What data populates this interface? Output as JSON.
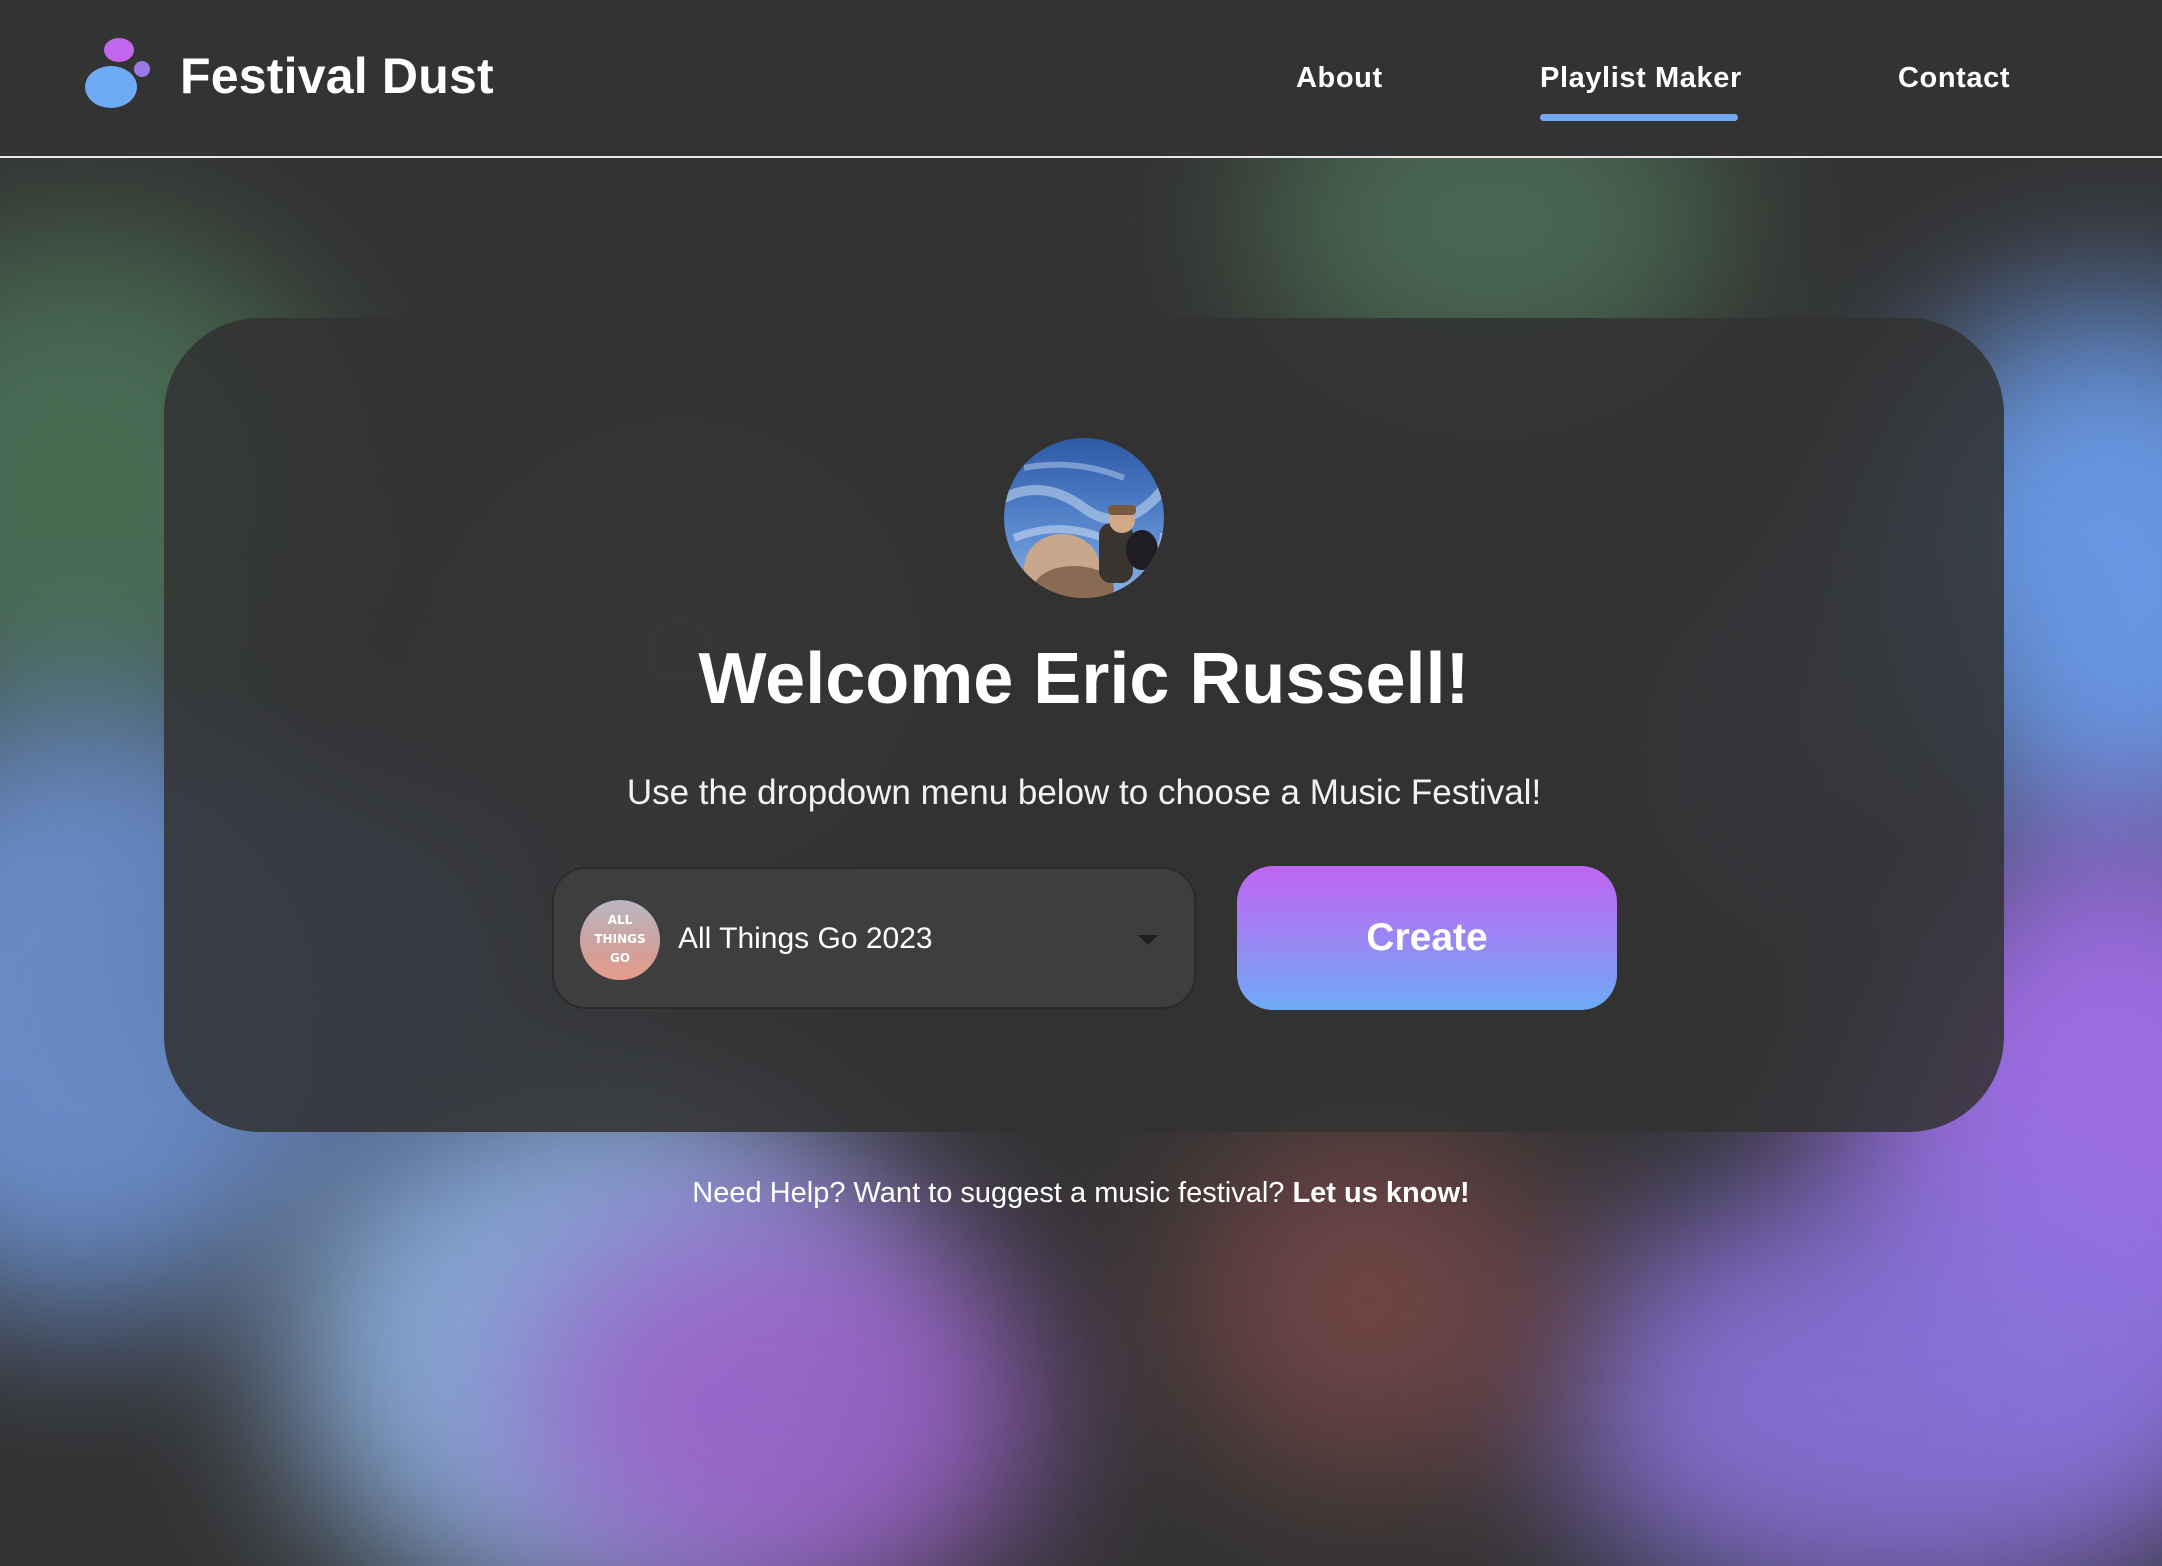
{
  "brand": {
    "name": "Festival Dust",
    "logo_icon": "bubbles-logo-icon",
    "logo_colors": [
      "#c266ee",
      "#6eaaf6",
      "#9a78ea"
    ]
  },
  "nav": {
    "items": [
      {
        "label": "About"
      },
      {
        "label": "Playlist Maker",
        "active": true
      },
      {
        "label": "Contact"
      }
    ],
    "active_indicator_color": "#74a8f0"
  },
  "main": {
    "avatar_alt": "profile-photo",
    "welcome": "Welcome Eric Russell!",
    "instructions": "Use the dropdown menu below to choose a Music Festival!",
    "festival_select": {
      "selected": "All Things Go 2023",
      "logo_text": [
        "ALL",
        "THINGS",
        "GO"
      ],
      "caret_icon": "caret-down-icon"
    },
    "create_label": "Create",
    "create_gradient": [
      "#c064f2",
      "#6eaaf6"
    ]
  },
  "footer": {
    "help_text": "Need Help? Want to suggest a music festival?",
    "help_link": "Let us know!"
  }
}
